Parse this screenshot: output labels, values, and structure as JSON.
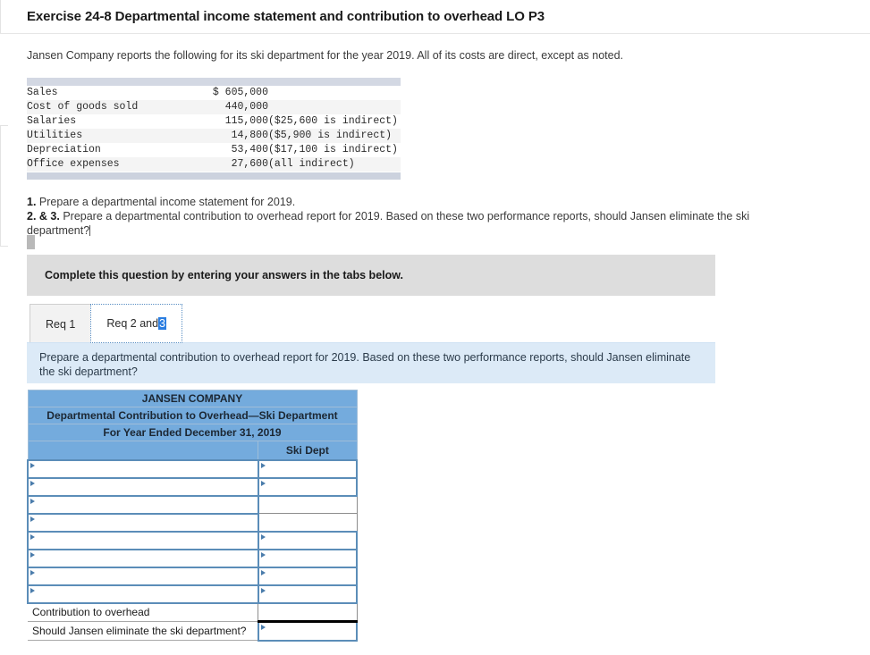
{
  "exercise": {
    "title": "Exercise 24-8 Departmental income statement and contribution to overhead LO P3",
    "intro": "Jansen Company reports the following for its ski department for the year 2019. All of its costs are direct, except as noted."
  },
  "given_data": {
    "rows": [
      {
        "label": "Sales",
        "amount": "$ 605,000",
        "note": ""
      },
      {
        "label": "Cost of goods sold",
        "amount": "440,000",
        "note": ""
      },
      {
        "label": "Salaries",
        "amount": "115,000",
        "note": "($25,600 is indirect)"
      },
      {
        "label": "Utilities",
        "amount": "14,800",
        "note": "($5,900 is indirect)"
      },
      {
        "label": "Depreciation",
        "amount": "53,400",
        "note": "($17,100 is indirect)"
      },
      {
        "label": "Office expenses",
        "amount": "27,600",
        "note": "(all indirect)"
      }
    ]
  },
  "requirements": {
    "item1_num": "1.",
    "item1_text": "Prepare a departmental income statement for 2019.",
    "item2_num": "2. & 3.",
    "item2_text": "Prepare a departmental contribution to overhead report for 2019. Based on these two performance reports, should Jansen eliminate the ski department?"
  },
  "banner": {
    "text": "Complete this question by entering your answers in the tabs below."
  },
  "tabs": [
    {
      "label": "Req 1",
      "active": false
    },
    {
      "label_prefix": "Req 2 and ",
      "label_highlight": "3",
      "active": true
    }
  ],
  "prompt": {
    "text": "Prepare a departmental contribution to overhead report for 2019. Based on these two performance reports, should Jansen eliminate the ski department?"
  },
  "worksheet": {
    "title_line1": "JANSEN COMPANY",
    "title_line2": "Departmental Contribution to Overhead—Ski Department",
    "title_line3": "For Year Ended December 31, 2019",
    "col_header_left": "",
    "col_header_right": "Ski Dept",
    "blank_rows": 8,
    "footer_rows": [
      {
        "label": "Contribution to overhead",
        "style": "plainbox"
      },
      {
        "label": "Should Jansen eliminate the ski department?",
        "style": "input"
      }
    ]
  },
  "colors": {
    "header_blue": "#74abdd",
    "prompt_blue": "#dceaf7",
    "banner_grey": "#dddddd",
    "given_bar": "#d3d8e3",
    "cell_border_blue": "#5b8db8",
    "selection_blue": "#2a7de1"
  }
}
